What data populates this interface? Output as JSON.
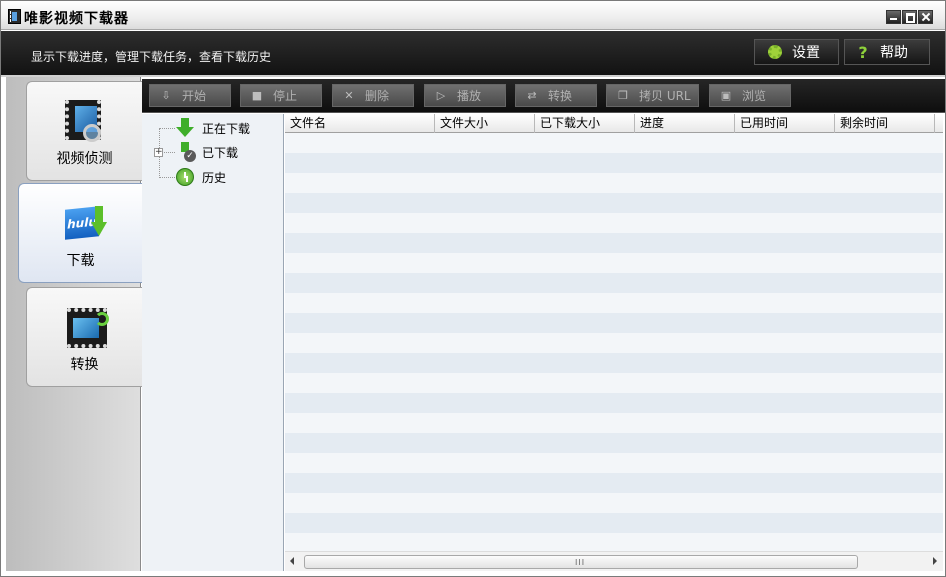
{
  "window": {
    "title": "唯影视频下载器"
  },
  "header": {
    "subtitle": "显示下载进度，管理下载任务，查看下载历史",
    "settings_label": "设置",
    "help_label": "帮助",
    "help_glyph": "?"
  },
  "nav": {
    "items": [
      {
        "label": "视频侦测",
        "icon": "film-search-icon"
      },
      {
        "label": "下载",
        "icon": "hulu-download-icon",
        "active": true
      },
      {
        "label": "转换",
        "icon": "film-convert-icon"
      }
    ]
  },
  "toolbar": {
    "start": "开始",
    "stop": "停止",
    "delete": "删除",
    "play": "播放",
    "convert": "转换",
    "copy_url": "拷贝 URL",
    "browse": "浏览"
  },
  "tree": {
    "downloading": "正在下载",
    "downloaded": "已下载",
    "history": "历史"
  },
  "list": {
    "columns": [
      "文件名",
      "文件大小",
      "已下载大小",
      "进度",
      "已用时间",
      "剩余时间"
    ],
    "scroll_grip": "III"
  },
  "colors": {
    "accent_green": "#5cbf2a",
    "dark_band": "#1a1a1a",
    "row_alt": "#e4ebf2"
  }
}
